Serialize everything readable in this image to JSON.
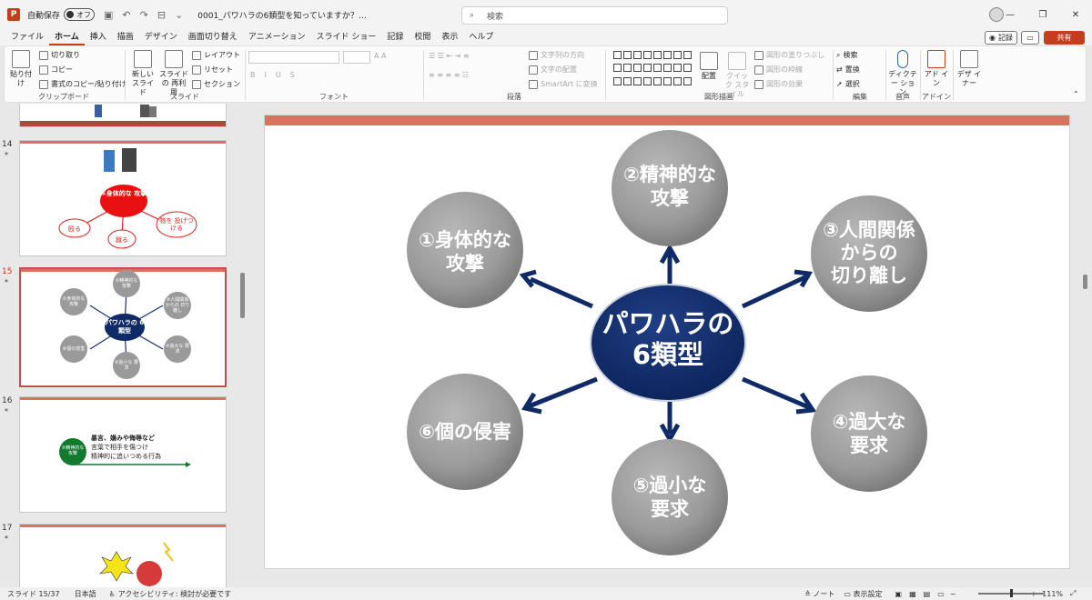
{
  "titlebar": {
    "autosave_label": "自動保存",
    "autosave_state": "オフ",
    "doc_title": "0001_パワハラの6類型を知っていますか？…",
    "search_placeholder": "検索"
  },
  "menu": {
    "tabs": [
      "ファイル",
      "ホーム",
      "挿入",
      "描画",
      "デザイン",
      "画面切り替え",
      "アニメーション",
      "スライド ショー",
      "記録",
      "校閲",
      "表示",
      "ヘルプ"
    ],
    "active_tab": "ホーム",
    "record": "記録",
    "share": "共有"
  },
  "ribbon": {
    "clipboard": {
      "paste": "貼り付け",
      "cut": "切り取り",
      "copy": "コピー",
      "format_painter": "書式のコピー/貼り付け",
      "label": "クリップボード"
    },
    "slides": {
      "new_slide": "新しい スライド",
      "reuse_slide": "スライドの 再利用",
      "layout": "レイアウト",
      "reset": "リセット",
      "section": "セクション",
      "label": "スライド"
    },
    "font": {
      "bold": "B",
      "italic": "I",
      "underline": "U",
      "strike": "S",
      "label": "フォント"
    },
    "paragraph": {
      "text_direction": "文字列の方向",
      "align_text": "文字の配置",
      "smartart": "SmartArt に変換",
      "label": "段落"
    },
    "drawing": {
      "arrange": "配置",
      "quick_styles": "クイック スタイル",
      "shape_fill": "図形の塗りつぶし",
      "shape_outline": "図形の枠線",
      "shape_effects": "図形の効果",
      "label": "図形描画"
    },
    "editing": {
      "find": "検索",
      "replace": "置換",
      "select": "選択",
      "label": "編集"
    },
    "voice": {
      "dictate": "ディクテー ション",
      "label": "音声"
    },
    "addins": {
      "addins": "アド イン",
      "label": "アドイン"
    },
    "designer": {
      "designer": "デザ イナー"
    }
  },
  "thumbnails": [
    {
      "num": "14",
      "star": "*",
      "center": "①身体的な 攻撃",
      "leaves": [
        "殴る",
        "蹴る",
        "物を 投げつける"
      ]
    },
    {
      "num": "15",
      "star": "*",
      "center": "パワハラの 6類型",
      "mini": [
        "①身体的な 攻撃",
        "②精神的な 攻撃",
        "③人間関係 からの 切り離し",
        "④過大な 要求",
        "⑤過小な 要求",
        "⑥個の侵害"
      ]
    },
    {
      "num": "16",
      "star": "*",
      "badge": "②精神的な 攻撃",
      "line1": "暴言、嫌みや侮辱など",
      "line2": "言葉で相手を傷つけ",
      "line3": "精神的に追いつめる行為"
    },
    {
      "num": "17",
      "star": "*"
    }
  ],
  "slide": {
    "center": [
      "パワハラの",
      "6類型"
    ],
    "items": [
      {
        "id": "1",
        "lines": [
          "①身体的な",
          "攻撃"
        ]
      },
      {
        "id": "2",
        "lines": [
          "②精神的な",
          "攻撃"
        ]
      },
      {
        "id": "3",
        "lines": [
          "③人間関係",
          "からの",
          "切り離し"
        ]
      },
      {
        "id": "4",
        "lines": [
          "④過大な",
          "要求"
        ]
      },
      {
        "id": "5",
        "lines": [
          "⑤過小な",
          "要求"
        ]
      },
      {
        "id": "6",
        "lines": [
          "⑥個の侵害"
        ]
      }
    ]
  },
  "status": {
    "slide_count": "スライド 15/37",
    "language": "日本語",
    "accessibility": "アクセシビリティ: 検討が必要です",
    "notes": "ノート",
    "display_settings": "表示設定",
    "zoom": "111%"
  },
  "colors": {
    "accent": "#c43e1c",
    "navy": "#0f2a66",
    "topbar": "#d9735f",
    "circle": "#9a9a9a"
  }
}
